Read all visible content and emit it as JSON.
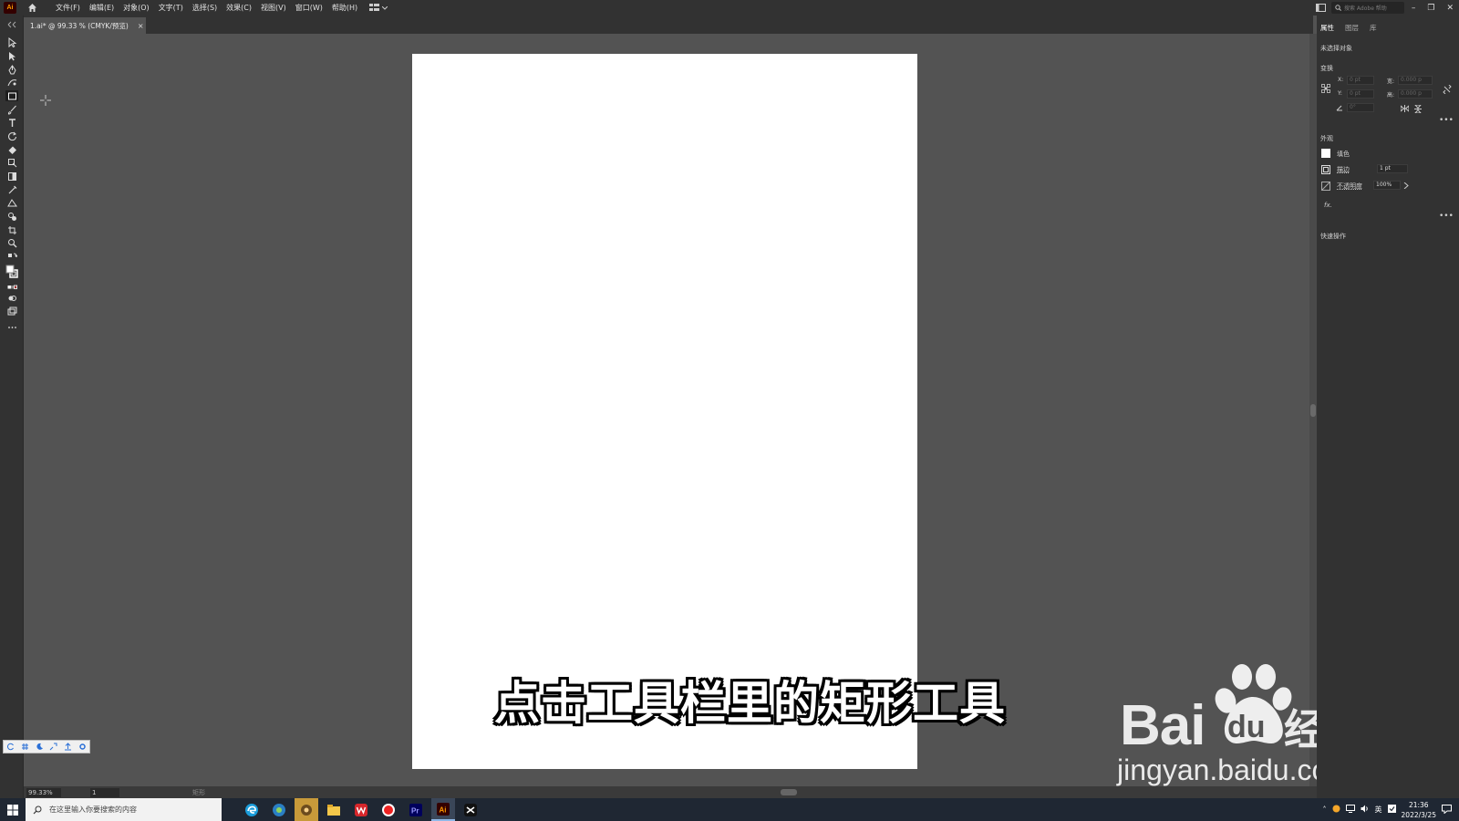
{
  "app": {
    "logo_text": "Ai",
    "menus": [
      "文件(F)",
      "编辑(E)",
      "对象(O)",
      "文字(T)",
      "选择(S)",
      "效果(C)",
      "视图(V)",
      "窗口(W)",
      "帮助(H)"
    ],
    "search_placeholder": "搜索 Adobe 帮助"
  },
  "document_tab": {
    "title": "1.ai* @ 99.33 % (CMYK/预览)",
    "close": "×"
  },
  "canvas": {
    "subtitle": "点击工具栏里的矩形工具"
  },
  "watermark": {
    "bai": "Bai",
    "du": "du",
    "jingyan": "经验",
    "url": "jingyan.baidu.com"
  },
  "right_panel": {
    "tabs": [
      "属性",
      "图层",
      "库"
    ],
    "no_selection": "未选择对象",
    "transform_label": "变换",
    "x_label": "X:",
    "y_label": "Y:",
    "w_label": "宽:",
    "h_label": "高:",
    "x_value": "0 pt",
    "y_value": "0 pt",
    "w_value": "0.000 p",
    "h_value": "0.000 p",
    "angle_value": "0°",
    "appearance_label": "外观",
    "fill_label": "填色",
    "stroke_label": "描边",
    "stroke_value": "1 pt",
    "opacity_label": "不透明度",
    "opacity_value": "100%",
    "fx_label": "fx.",
    "quick_actions_label": "快速操作",
    "more": "•••"
  },
  "status_bar": {
    "zoom": "99.33%",
    "page": "1",
    "tool": "矩形"
  },
  "taskbar": {
    "search_placeholder": "在这里输入你要搜索的内容",
    "time": "21:36",
    "date": "2022/3/25",
    "ime": "英"
  },
  "colors": {
    "accent_orange": "#ff9a00",
    "panel_bg": "#323232",
    "canvas_bg": "#535353",
    "artboard": "#ffffff"
  }
}
